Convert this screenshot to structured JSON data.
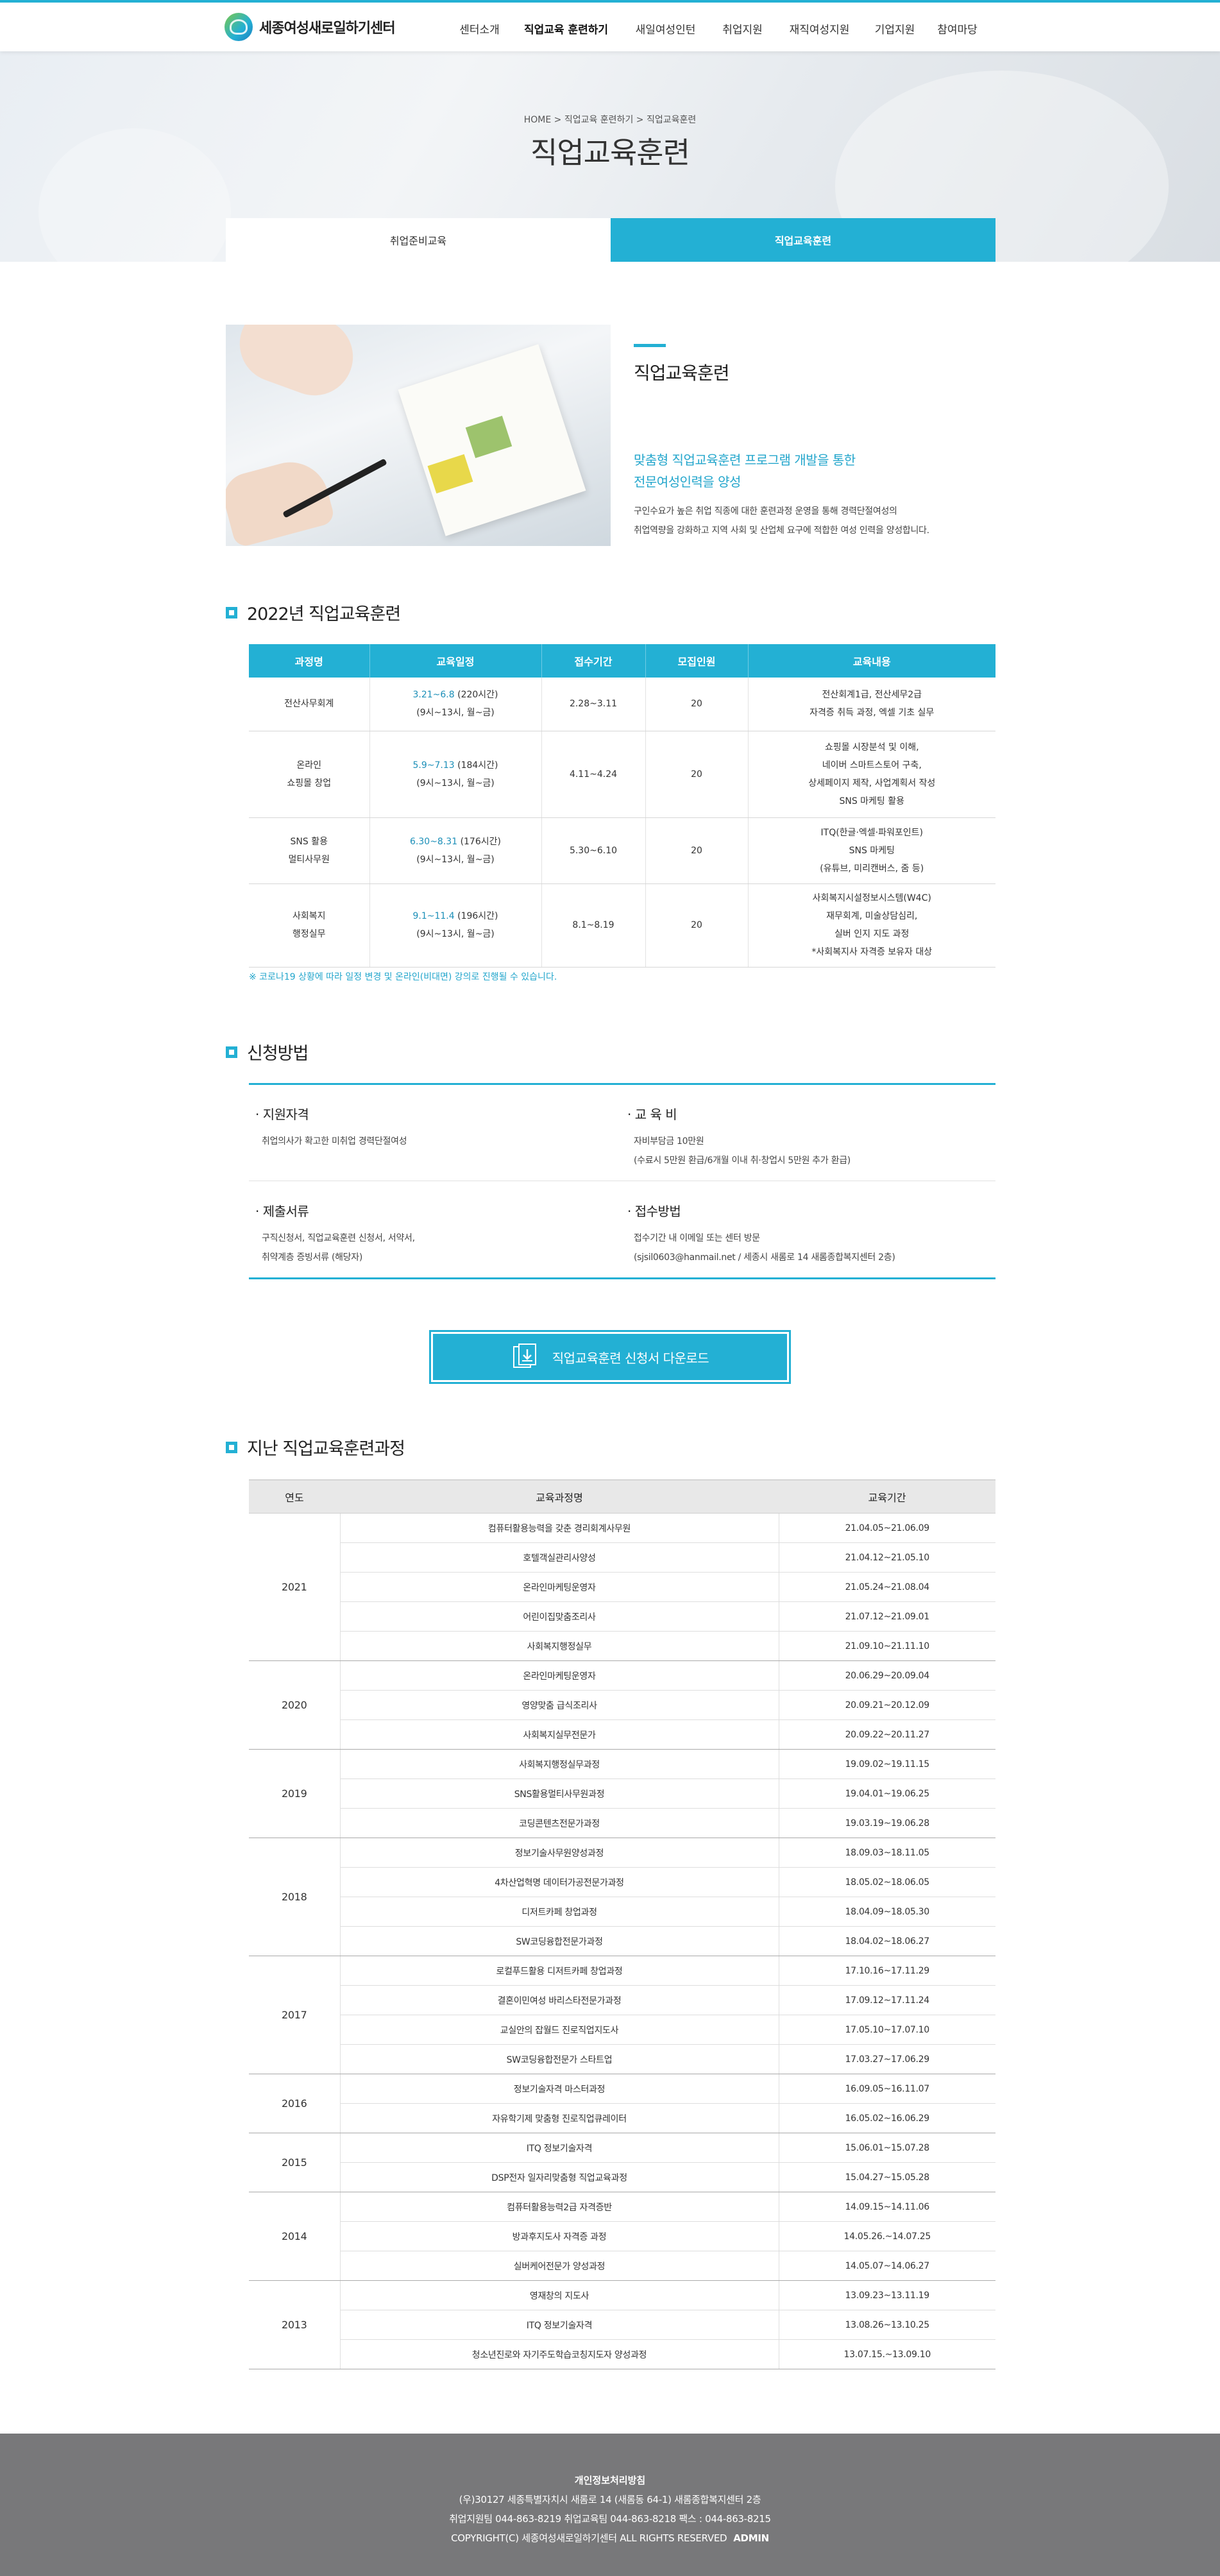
{
  "header": {
    "logo_text": "세종여성새로일하기센터",
    "nav": [
      "센터소개",
      "직업교육 훈련하기",
      "새일여성인턴",
      "취업지원",
      "재직여성지원",
      "기업지원",
      "참여마당"
    ]
  },
  "visual": {
    "breadcrumb": "HOME > 직업교육 훈련하기 > 직업교육훈련",
    "title": "직업교육훈련",
    "tabs": [
      "취업준비교육",
      "직업교육훈련"
    ]
  },
  "intro": {
    "title": "직업교육훈련",
    "lead_1": "맞춤형 직업교육훈련 프로그램 개발을 통한",
    "lead_2": "전문여성인력을 양성",
    "desc_1": "구인수요가 높은 취업 직종에 대한 훈련과정 운영을 통해 경력단절여성의",
    "desc_2": "취업역량을 강화하고 지역 사회 및 산업체 요구에 적합한 여성 인력을 양성합니다."
  },
  "section_2022": {
    "title": "2022년 직업교육훈련",
    "headers": [
      "과정명",
      "교육일정",
      "접수기간",
      "모집인원",
      "교육내용"
    ],
    "rows": [
      {
        "name": [
          "전산사무회계"
        ],
        "date": "3.21~6.8",
        "hours": "(220시간)",
        "time": "(9시~13시, 월~금)",
        "recv": "2.28~3.11",
        "count": "20",
        "content": [
          "전산회계1급, 전산세무2급",
          "자격증 취득 과정, 엑셀 기초 실무"
        ]
      },
      {
        "name": [
          "온라인",
          "쇼핑몰 창업"
        ],
        "date": "5.9~7.13",
        "hours": "(184시간)",
        "time": "(9시~13시, 월~금)",
        "recv": "4.11~4.24",
        "count": "20",
        "content": [
          "쇼핑몰 시장분석 및 이해,",
          "네이버 스마트스토어 구축,",
          "상세페이지 제작, 사업계획서 작성",
          "SNS 마케팅 활용"
        ]
      },
      {
        "name": [
          "SNS 활용",
          "멀티사무원"
        ],
        "date": "6.30~8.31",
        "hours": "(176시간)",
        "time": "(9시~13시, 월~금)",
        "recv": "5.30~6.10",
        "count": "20",
        "content": [
          "ITQ(한글·엑셀·파워포인트)",
          "SNS 마케팅",
          "(유튜브, 미리캔버스, 줌 등)"
        ]
      },
      {
        "name": [
          "사회복지",
          "행정실무"
        ],
        "date": "9.1~11.4",
        "hours": "(196시간)",
        "time": "(9시~13시, 월~금)",
        "recv": "8.1~8.19",
        "count": "20",
        "content": [
          "사회복지시설정보시스템(W4C)",
          "재무회계, 미술상담심리,",
          "실버 인지 지도 과정",
          "*사회복지사 자격증 보유자 대상"
        ]
      }
    ],
    "notice": "※ 코로나19 상황에 따라 일정 변경 및 온라인(비대면) 강의로 진행될 수 있습니다."
  },
  "apply": {
    "title": "신청방법",
    "items": [
      {
        "head": "· 지원자격",
        "lines": [
          "취업의사가 확고한 미취업 경력단절여성"
        ]
      },
      {
        "head": "· 교 육 비",
        "lines": [
          "자비부담금 10만원",
          "(수료시 5만원 환급/6개월 이내 취·창업시 5만원 추가 환급)"
        ]
      },
      {
        "head": "· 제출서류",
        "lines": [
          "구직신청서, 직업교육훈련 신청서, 서약서,",
          "취약계층 증빙서류 (해당자)"
        ]
      },
      {
        "head": "· 접수방법",
        "lines": [
          "접수기간 내 이메일 또는 센터 방문",
          "(sjsil0603@hanmail.net / 세종시 새롬로 14 새롬종합복지센터 2층)"
        ]
      }
    ],
    "download_label": "직업교육훈련 신청서 다운로드"
  },
  "history": {
    "title": "지난 직업교육훈련과정",
    "headers": [
      "연도",
      "교육과정명",
      "교육기간"
    ],
    "groups": [
      {
        "year": "2021",
        "courses": [
          [
            "컴퓨터활용능력을 갖춘 경리회계사무원",
            "21.04.05~21.06.09"
          ],
          [
            "호텔객실관리사양성",
            "21.04.12~21.05.10"
          ],
          [
            "온라인마케팅운영자",
            "21.05.24~21.08.04"
          ],
          [
            "어린이집맞춤조리사",
            "21.07.12~21.09.01"
          ],
          [
            "사회복지행정실무",
            "21.09.10~21.11.10"
          ]
        ]
      },
      {
        "year": "2020",
        "courses": [
          [
            "온라인마케팅운영자",
            "20.06.29~20.09.04"
          ],
          [
            "영양맞춤 급식조리사",
            "20.09.21~20.12.09"
          ],
          [
            "사회복지실무전문가",
            "20.09.22~20.11.27"
          ]
        ]
      },
      {
        "year": "2019",
        "courses": [
          [
            "사회복지행정실무과정",
            "19.09.02~19.11.15"
          ],
          [
            "SNS활용멀티사무원과정",
            "19.04.01~19.06.25"
          ],
          [
            "코딩콘텐츠전문가과정",
            "19.03.19~19.06.28"
          ]
        ]
      },
      {
        "year": "2018",
        "courses": [
          [
            "정보기술사무원양성과정",
            "18.09.03~18.11.05"
          ],
          [
            "4차산업혁명 데이터가공전문가과정",
            "18.05.02~18.06.05"
          ],
          [
            "디저트카페 창업과정",
            "18.04.09~18.05.30"
          ],
          [
            "SW코딩융합전문가과정",
            "18.04.02~18.06.27"
          ]
        ]
      },
      {
        "year": "2017",
        "courses": [
          [
            "로컬푸드활용 디저트카페 창업과정",
            "17.10.16~17.11.29"
          ],
          [
            "결혼이민여성 바리스타전문가과정",
            "17.09.12~17.11.24"
          ],
          [
            "교실안의 잡월드 진로직업지도사",
            "17.05.10~17.07.10"
          ],
          [
            "SW코딩융합전문가 스타트업",
            "17.03.27~17.06.29"
          ]
        ]
      },
      {
        "year": "2016",
        "courses": [
          [
            "정보기술자격 마스터과정",
            "16.09.05~16.11.07"
          ],
          [
            "자유학기제 맞춤형 진로직업큐레이터",
            "16.05.02~16.06.29"
          ]
        ]
      },
      {
        "year": "2015",
        "courses": [
          [
            "ITQ 정보기술자격",
            "15.06.01~15.07.28"
          ],
          [
            "DSP전자 일자리맞춤형 직업교육과정",
            "15.04.27~15.05.28"
          ]
        ]
      },
      {
        "year": "2014",
        "courses": [
          [
            "컴퓨터활용능력2급 자격증반",
            "14.09.15~14.11.06"
          ],
          [
            "방과후지도사 자격증 과정",
            "14.05.26.~14.07.25"
          ],
          [
            "실버케어전문가 양성과정",
            "14.05.07~14.06.27"
          ]
        ]
      },
      {
        "year": "2013",
        "courses": [
          [
            "영재창의 지도사",
            "13.09.23~13.11.19"
          ],
          [
            "ITQ 정보기술자격",
            "13.08.26~13.10.25"
          ],
          [
            "청소년진로와 자기주도학습코칭지도자 양성과정",
            "13.07.15.~13.09.10"
          ]
        ]
      }
    ]
  },
  "footer": {
    "policy": "개인정보처리방침",
    "address": "(우)30127 세종특별자치시 새롬로 14 (새롬동 64-1) 새롬종합복지센터 2층",
    "contact": "취업지원팀 044-863-8219    취업교육팀 044-863-8218    팩스 : 044-863-8215",
    "copyright": "COPYRIGHT(C) 세종여성새로일하기센터 ALL RIGHTS RESERVED",
    "admin": "ADMIN"
  },
  "colors": {
    "accent": "#23b0d4",
    "footer_bg": "#78787a",
    "lead_text": "#23a6cc"
  }
}
